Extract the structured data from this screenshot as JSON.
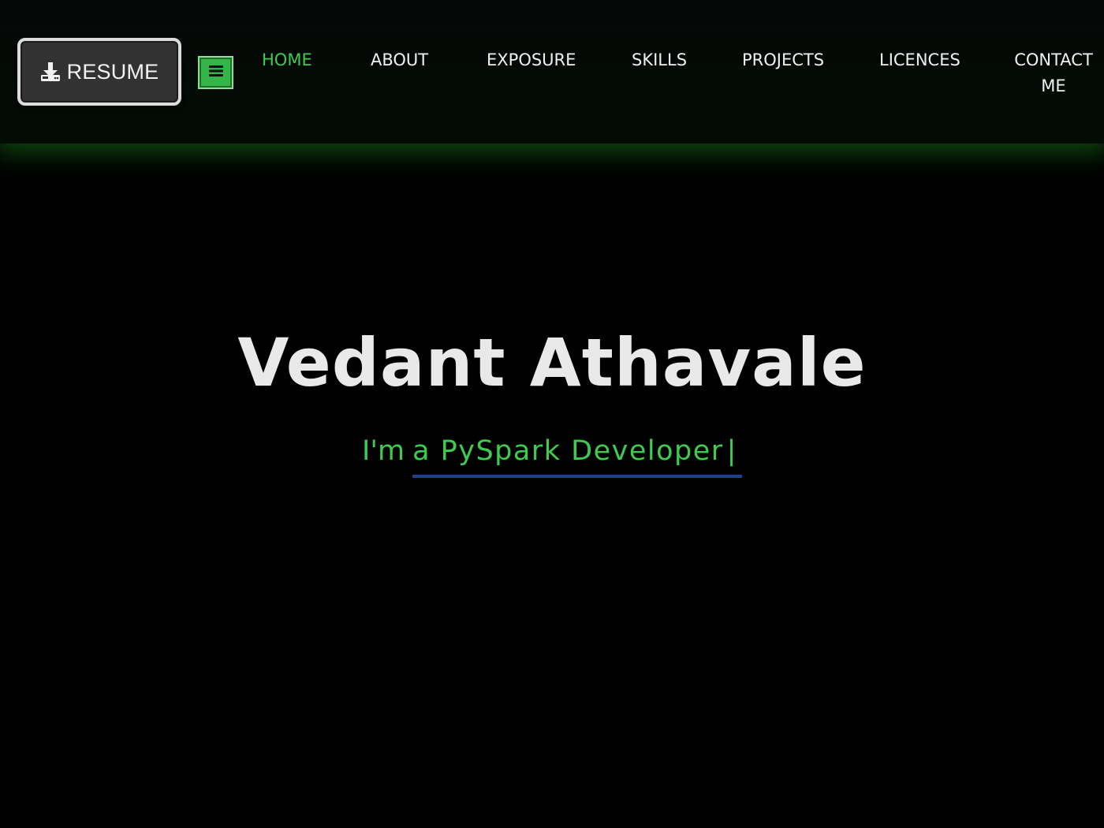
{
  "header": {
    "resume_button": {
      "label": "RESUME",
      "icon": "download-icon"
    },
    "menu_toggle": {
      "icon": "hamburger-icon",
      "color": "#35b447"
    },
    "nav": {
      "items": [
        {
          "label": "HOME",
          "active": true
        },
        {
          "label": "ABOUT",
          "active": false
        },
        {
          "label": "EXPOSURE",
          "active": false
        },
        {
          "label": "SKILLS",
          "active": false
        },
        {
          "label": "PROJECTS",
          "active": false
        },
        {
          "label": "LICENCES",
          "active": false
        },
        {
          "label": "CONTACT ME",
          "active": false
        }
      ],
      "active_color": "#3ecb4f"
    }
  },
  "hero": {
    "name": "Vedant Athavale",
    "tagline_prefix": "I'm",
    "typed_text": "a PySpark Developer",
    "cursor": "|",
    "accent_color": "#3ecb4f",
    "underline_color": "#1f3f86"
  }
}
